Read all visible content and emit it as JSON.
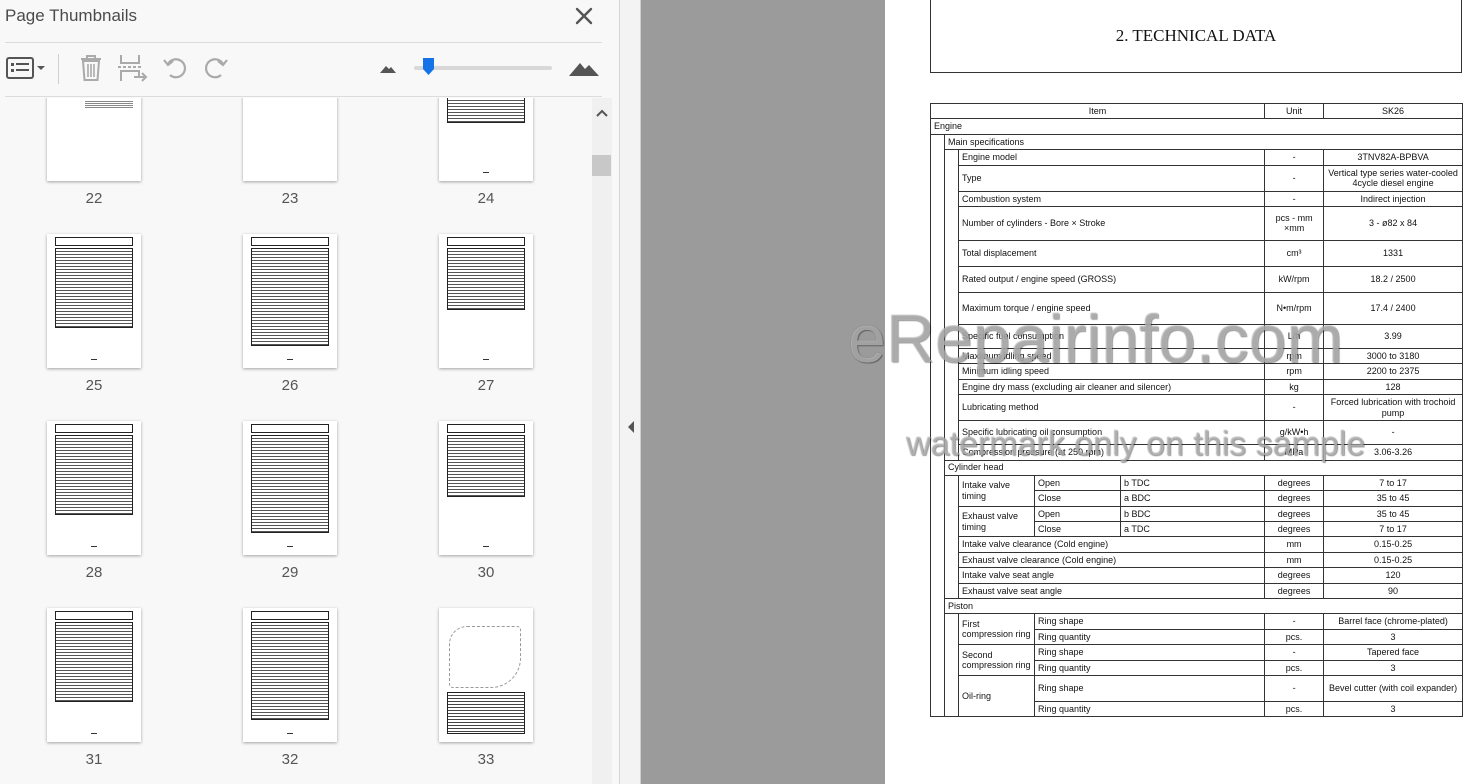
{
  "panel": {
    "title": "Page Thumbnails",
    "toolbar": {
      "options_label": "Thumbnail options",
      "delete_label": "Delete pages",
      "extract_label": "Extract pages",
      "undo_label": "Undo",
      "redo_label": "Redo",
      "zoom_out_label": "Zoom out",
      "zoom_in_label": "Zoom in",
      "zoom_level": 0.1
    },
    "thumbnails": [
      {
        "page": "22"
      },
      {
        "page": "23"
      },
      {
        "page": "24"
      },
      {
        "page": "25"
      },
      {
        "page": "26"
      },
      {
        "page": "27"
      },
      {
        "page": "28"
      },
      {
        "page": "29"
      },
      {
        "page": "30"
      },
      {
        "page": "31"
      },
      {
        "page": "32"
      },
      {
        "page": "33"
      }
    ]
  },
  "document": {
    "title": "2. TECHNICAL DATA",
    "table": {
      "headers": [
        "Item",
        "Unit",
        "SK26"
      ],
      "engine": "Engine",
      "main_specs": "Main specifications",
      "main_rows": [
        {
          "item": "Engine model",
          "unit": "-",
          "value": "3TNV82A-BPBVA"
        },
        {
          "item": "Type",
          "unit": "-",
          "value": "Vertical type series water-cooled 4cycle diesel engine"
        },
        {
          "item": "Combustion system",
          "unit": "-",
          "value": "Indirect injection"
        },
        {
          "item": "Number of cylinders - Bore × Stroke",
          "unit": "pcs - mm ×mm",
          "value": "3 - ø82 x 84"
        },
        {
          "item": "Total displacement",
          "unit": "cm³",
          "value": "1331"
        },
        {
          "item": "Rated output / engine speed (GROSS)",
          "unit": "kW/rpm",
          "value": "18.2 / 2500"
        },
        {
          "item": "Maximum torque / engine speed",
          "unit": "N•m/rpm",
          "value": "17.4 / 2400"
        },
        {
          "item": "Specific fuel consumption",
          "unit": "L/h",
          "value": "3.99"
        },
        {
          "item": "Maximum idling speed",
          "unit": "rpm",
          "value": "3000 to 3180"
        },
        {
          "item": "Minimum idling speed",
          "unit": "rpm",
          "value": "2200 to 2375"
        },
        {
          "item": "Engine dry mass (excluding air cleaner and silencer)",
          "unit": "kg",
          "value": "128"
        },
        {
          "item": "Lubricating method",
          "unit": "-",
          "value": "Forced lubrication with trochoid pump"
        },
        {
          "item": "Specific lubricating oil consumption",
          "unit": "g/kW•h",
          "value": "-"
        },
        {
          "item": "Compression pressure (at 250 rpm)",
          "unit": "MPa",
          "value": "3.06-3.26"
        }
      ],
      "cylinder_head": "Cylinder head",
      "intake_valve_timing": "Intake valve timing",
      "exhaust_valve_timing": "Exhaust valve timing",
      "intake_rows": [
        {
          "state": "Open",
          "ref": "b TDC",
          "unit": "degrees",
          "value": "7 to 17"
        },
        {
          "state": "Close",
          "ref": "a BDC",
          "unit": "degrees",
          "value": "35 to 45"
        }
      ],
      "exhaust_rows": [
        {
          "state": "Open",
          "ref": "b BDC",
          "unit": "degrees",
          "value": "35 to 45"
        },
        {
          "state": "Close",
          "ref": "a TDC",
          "unit": "degrees",
          "value": "7 to 17"
        }
      ],
      "head_rows": [
        {
          "item": "Intake valve clearance (Cold engine)",
          "unit": "mm",
          "value": "0.15-0.25"
        },
        {
          "item": "Exhaust valve clearance (Cold engine)",
          "unit": "mm",
          "value": "0.15-0.25"
        },
        {
          "item": "Intake valve seat angle",
          "unit": "degrees",
          "value": "120"
        },
        {
          "item": "Exhaust valve seat angle",
          "unit": "degrees",
          "value": "90"
        }
      ],
      "piston": "Piston",
      "first_ring": "First compression ring",
      "second_ring": "Second compression ring",
      "oil_ring": "Oil-ring",
      "ring_shape": "Ring shape",
      "ring_quantity": "Ring quantity",
      "first_ring_shape": "Barrel face (chrome-plated)",
      "first_ring_qty": "3",
      "second_ring_shape": "Tapered face",
      "second_ring_qty": "3",
      "oil_ring_shape": "Bevel cutter (with coil expander)",
      "oil_ring_qty": "3",
      "unit_dash": "-",
      "unit_pcs": "pcs."
    }
  },
  "watermark": {
    "main": "eRepairinfo.com",
    "sub": "watermark only on this sample"
  },
  "colors": {
    "panel_bg": "#f8f8f8",
    "doc_bg": "#9b9b9b",
    "zoom_accent": "#1473e6"
  }
}
